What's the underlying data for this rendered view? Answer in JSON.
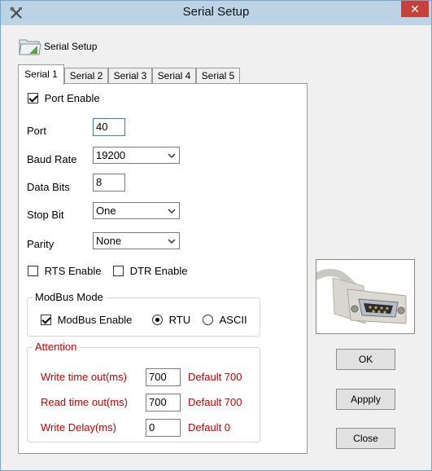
{
  "window": {
    "title": "Serial Setup",
    "close_glyph": "✕"
  },
  "header": {
    "label": "Serial Setup",
    "icon": "folder-icon"
  },
  "tabs": [
    {
      "label": "Serial 1",
      "active": true
    },
    {
      "label": "Serial 2",
      "active": false
    },
    {
      "label": "Serial 3",
      "active": false
    },
    {
      "label": "Serial 4",
      "active": false
    },
    {
      "label": "Serial 5",
      "active": false
    }
  ],
  "form": {
    "port_enable": {
      "label": "Port Enable",
      "checked": true
    },
    "port": {
      "label": "Port",
      "value": "40"
    },
    "baud_rate": {
      "label": "Baud Rate",
      "value": "19200"
    },
    "data_bits": {
      "label": "Data Bits",
      "value": "8"
    },
    "stop_bit": {
      "label": "Stop Bit",
      "value": "One"
    },
    "parity": {
      "label": "Parity",
      "value": "None"
    },
    "rts_enable": {
      "label": "RTS Enable",
      "checked": false
    },
    "dtr_enable": {
      "label": "DTR Enable",
      "checked": false
    }
  },
  "modbus": {
    "title": "ModBus Mode",
    "enable": {
      "label": "ModBus Enable",
      "checked": true
    },
    "rtu": {
      "label": "RTU",
      "selected": true
    },
    "ascii": {
      "label": "ASCII",
      "selected": false
    }
  },
  "attention": {
    "title": "Attention",
    "write_timeout": {
      "label": "Write time out(ms)",
      "value": "700",
      "default": "Default 700"
    },
    "read_timeout": {
      "label": "Read time out(ms)",
      "value": "700",
      "default": "Default 700"
    },
    "write_delay": {
      "label": "Write Delay(ms)",
      "value": "0",
      "default": "Default 0"
    }
  },
  "buttons": {
    "ok": "OK",
    "apply": "Appply",
    "close": "Close"
  },
  "colors": {
    "attention_red": "#c00000",
    "title_bar": "#bcd3e6",
    "close_red": "#c7403a"
  }
}
